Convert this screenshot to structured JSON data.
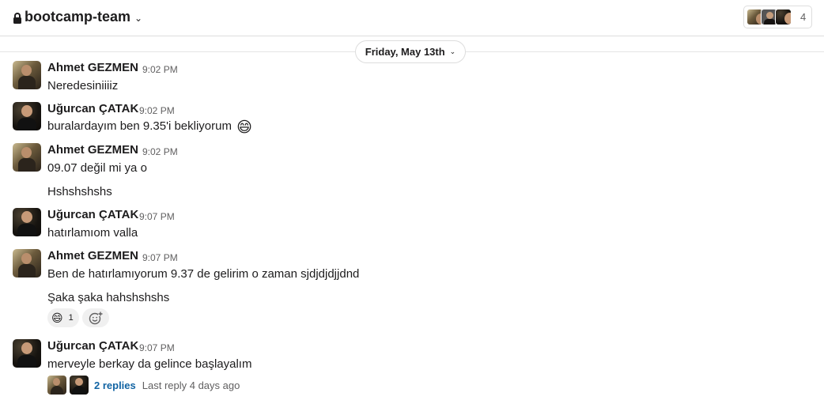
{
  "header": {
    "channel_name": "bootcamp-team",
    "member_count": "4"
  },
  "date_divider": "Friday, May 13th",
  "messages": [
    {
      "author": "Ahmet GEZMEN",
      "time": "9:02 PM",
      "text": "Neredesiniiiiz"
    },
    {
      "author": "Uğurcan ÇATAK",
      "time": "9:02 PM",
      "text": "buralardayım ben 9.35'i bekliyorum",
      "emoji": "😄"
    },
    {
      "author": "Ahmet GEZMEN",
      "time": "9:02 PM",
      "text": "09.07 değil mi ya o",
      "extra_text": "Hshshshshs"
    },
    {
      "author": "Uğurcan ÇATAK",
      "time": "9:07 PM",
      "text": "hatırlamıom valla"
    },
    {
      "author": "Ahmet GEZMEN",
      "time": "9:07 PM",
      "text": "Ben de hatırlamıyorum 9.37 de gelirim o zaman sjdjdjdjjdnd",
      "extra_text": "Şaka şaka hahshshshs",
      "reaction": {
        "emoji": "😄",
        "count": "1"
      }
    },
    {
      "author": "Uğurcan ÇATAK",
      "time": "9:07 PM",
      "text": "merveyle berkay da gelince başlayalım",
      "thread": {
        "replies": "2 replies",
        "last_reply": "Last reply 4 days ago"
      }
    }
  ]
}
